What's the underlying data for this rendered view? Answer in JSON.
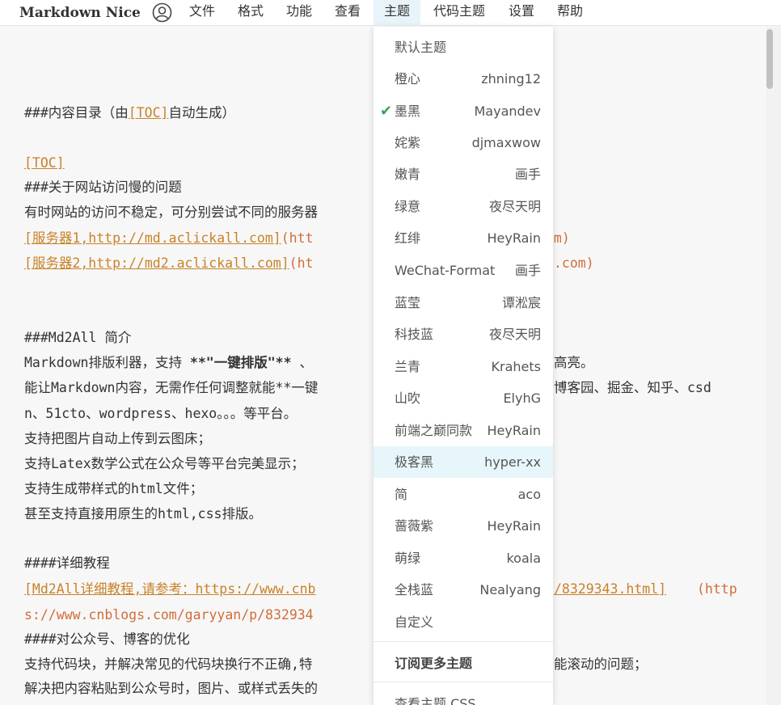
{
  "app": {
    "title": "Markdown Nice"
  },
  "menu": [
    {
      "label": "文件"
    },
    {
      "label": "格式"
    },
    {
      "label": "功能"
    },
    {
      "label": "查看"
    },
    {
      "label": "主题"
    },
    {
      "label": "代码主题"
    },
    {
      "label": "设置"
    },
    {
      "label": "帮助"
    }
  ],
  "editor": {
    "lines": {
      "l1a": "###内容目录（由",
      "l1b": "[TOC]",
      "l1c": "自动生成）",
      "l2": "[TOC]",
      "l3": "###关于网站访问慢的问题",
      "l4": "有时网站的访问不稳定，可分别尝试不同的服务器",
      "l5a": "[服务器1,http://md.aclickall.com]",
      "l5b": "(htt",
      "l5c": "om)",
      "l6a": "[服务器2,http://md2.aclickall.com]",
      "l6b": "(ht",
      "l6c": ".com)",
      "l7": "###Md2All 简介",
      "l8a": "Markdown排版利器，支持 ",
      "l8b": "**\"一键排版\"**",
      "l8c": " 、",
      "l8d": "高亮。",
      "l9a": "能让Markdown内容，无需作任何调整就能**一键",
      "l9b": "博客园、掘金、知乎、csd",
      "l10": "n、51cto、wordpress、hexo。。。等平台。",
      "l11": "支持把图片自动上传到云图床；",
      "l12": "支持Latex数学公式在公众号等平台完美显示；",
      "l13": "支持生成带样式的html文件；",
      "l14": "甚至支持直接用原生的html,css排版。",
      "l15": "####详细教程",
      "l16a": "[Md2All详细教程,请参考：https://www.cnb",
      "l16b": "/8329343.html]",
      "l16c": "(http",
      "l17": "s://www.cnblogs.com/garyyan/p/832934",
      "l18": "####对公众号、博客的优化",
      "l19a": "支持代码块，并解决常见的代码块换行不正确,特",
      "l19b": "能滚动的问题；",
      "l20": "解决把内容粘贴到公众号时，图片、或样式丢失的"
    }
  },
  "theme_menu": {
    "items": [
      {
        "name": "默认主题",
        "author": ""
      },
      {
        "name": "橙心",
        "author": "zhning12"
      },
      {
        "name": "墨黑",
        "author": "Mayandev",
        "checked": true
      },
      {
        "name": "姹紫",
        "author": "djmaxwow"
      },
      {
        "name": "嫩青",
        "author": "画手"
      },
      {
        "name": "绿意",
        "author": "夜尽天明"
      },
      {
        "name": "红绯",
        "author": "HeyRain"
      },
      {
        "name": "WeChat-Format",
        "author": "画手"
      },
      {
        "name": "蓝莹",
        "author": "谭淞宸"
      },
      {
        "name": "科技蓝",
        "author": "夜尽天明"
      },
      {
        "name": "兰青",
        "author": "Krahets"
      },
      {
        "name": "山吹",
        "author": "ElyhG"
      },
      {
        "name": "前端之巅同款",
        "author": "HeyRain"
      },
      {
        "name": "极客黑",
        "author": "hyper-xx",
        "hover": true
      },
      {
        "name": "简",
        "author": "aco"
      },
      {
        "name": "蔷薇紫",
        "author": "HeyRain"
      },
      {
        "name": "萌绿",
        "author": "koala"
      },
      {
        "name": "全栈蓝",
        "author": "Nealyang"
      },
      {
        "name": "自定义",
        "author": ""
      }
    ],
    "subscribe": "订阅更多主题",
    "view_css": "查看主题 CSS",
    "check_symbol": "✔"
  },
  "colors": {
    "accent_bg": "#e8f4fa",
    "link": "#c9822a",
    "check": "#3fa34d"
  }
}
